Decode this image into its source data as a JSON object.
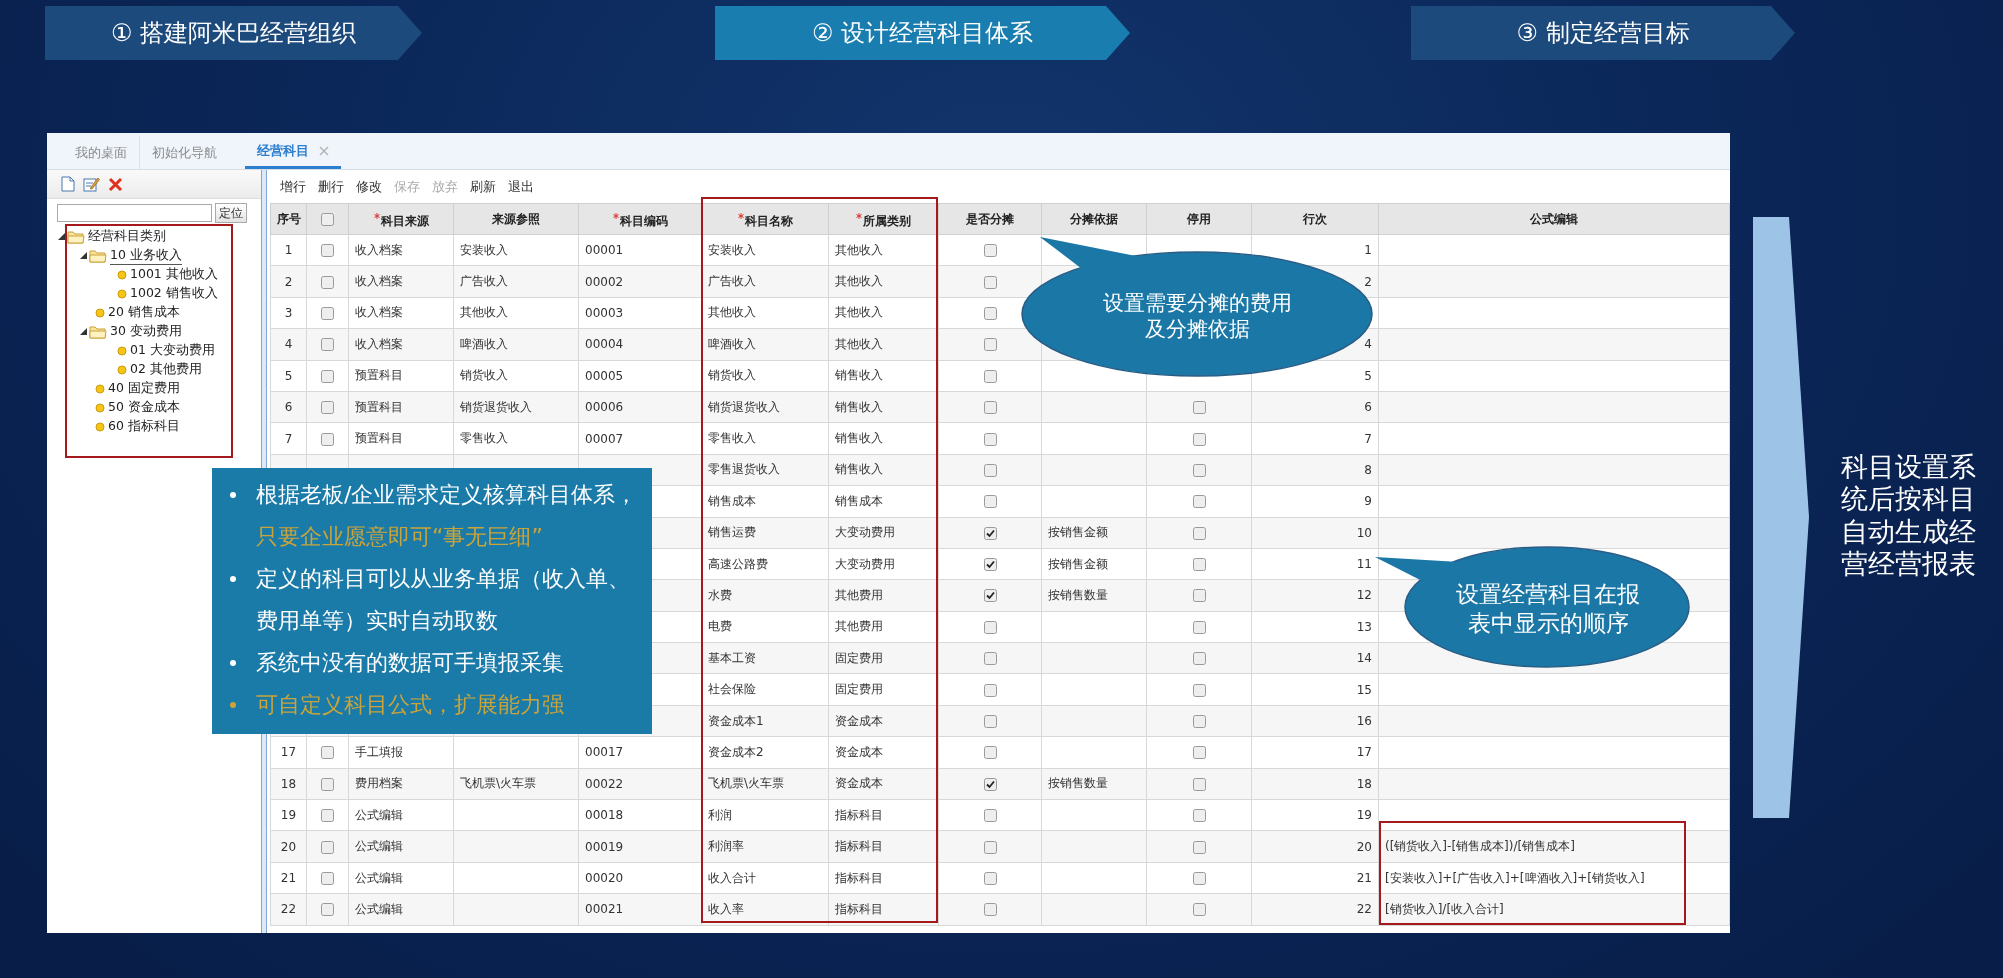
{
  "banners": [
    {
      "label": "① 搭建阿米巴经营组织",
      "selected": false
    },
    {
      "label": "② 设计经营科目体系",
      "selected": true
    },
    {
      "label": "③ 制定经营目标",
      "selected": false
    }
  ],
  "app": {
    "tabs": [
      {
        "label": "我的桌面",
        "selected": false,
        "closable": false
      },
      {
        "label": "初始化导航",
        "selected": false,
        "closable": false
      },
      {
        "label": "经营科目",
        "selected": true,
        "closable": true
      }
    ],
    "search": {
      "button": "定位"
    },
    "tree": {
      "items": [
        {
          "label": "经营科目类别",
          "kind": "folder",
          "expanded": true,
          "selected": false,
          "children": [
            {
              "label": "10 业务收入",
              "kind": "folder",
              "expanded": true,
              "selected": true,
              "children": [
                {
                  "label": "1001 其他收入",
                  "kind": "leaf",
                  "selected": false
                },
                {
                  "label": "1002 销售收入",
                  "kind": "leaf",
                  "selected": false
                }
              ]
            },
            {
              "label": "20 销售成本",
              "kind": "leaf",
              "selected": false
            },
            {
              "label": "30 变动费用",
              "kind": "folder",
              "expanded": true,
              "selected": false,
              "children": [
                {
                  "label": "01 大变动费用",
                  "kind": "leaf",
                  "selected": false
                },
                {
                  "label": "02 其他费用",
                  "kind": "leaf",
                  "selected": false
                }
              ]
            },
            {
              "label": "40 固定费用",
              "kind": "leaf",
              "selected": false
            },
            {
              "label": "50 资金成本",
              "kind": "leaf",
              "selected": false
            },
            {
              "label": "60 指标科目",
              "kind": "leaf",
              "selected": false
            }
          ]
        }
      ]
    },
    "toolbar": [
      {
        "label": "增行",
        "disabled": false
      },
      {
        "label": "删行",
        "disabled": false
      },
      {
        "label": "修改",
        "disabled": false
      },
      {
        "label": "保存",
        "disabled": true
      },
      {
        "label": "放弃",
        "disabled": true
      },
      {
        "label": "刷新",
        "disabled": false
      },
      {
        "label": "退出",
        "disabled": false
      }
    ],
    "table": {
      "columns": [
        {
          "kind": "text",
          "label": "序号",
          "required": false
        },
        {
          "kind": "checkbox",
          "checked": false
        },
        {
          "kind": "text",
          "label": "科目来源",
          "required": true
        },
        {
          "kind": "text",
          "label": "来源参照",
          "required": false
        },
        {
          "kind": "text",
          "label": "科目编码",
          "required": true
        },
        {
          "kind": "text",
          "label": "科目名称",
          "required": true
        },
        {
          "kind": "text",
          "label": "所属类别",
          "required": true
        },
        {
          "kind": "text",
          "label": "是否分摊",
          "required": false
        },
        {
          "kind": "text",
          "label": "分摊依据",
          "required": false
        },
        {
          "kind": "text",
          "label": "停用",
          "required": false
        },
        {
          "kind": "text",
          "label": "行次",
          "required": false
        },
        {
          "kind": "text",
          "label": "公式编辑",
          "required": false
        }
      ],
      "rows": [
        {
          "no": "1",
          "checked": false,
          "source": "收入档案",
          "ref": "安装收入",
          "code": "00001",
          "name": "安装收入",
          "category": "其他收入",
          "allocated": false,
          "order": "1"
        },
        {
          "no": "2",
          "checked": false,
          "source": "收入档案",
          "ref": "广告收入",
          "code": "00002",
          "name": "广告收入",
          "category": "其他收入",
          "allocated": false,
          "order": "2"
        },
        {
          "no": "3",
          "checked": false,
          "source": "收入档案",
          "ref": "其他收入",
          "code": "00003",
          "name": "其他收入",
          "category": "其他收入",
          "allocated": false
        },
        {
          "no": "4",
          "checked": false,
          "source": "收入档案",
          "ref": "啤酒收入",
          "code": "00004",
          "name": "啤酒收入",
          "category": "其他收入",
          "allocated": false,
          "order": "4"
        },
        {
          "no": "5",
          "checked": false,
          "source": "预置科目",
          "ref": "销货收入",
          "code": "00005",
          "name": "销货收入",
          "category": "销售收入",
          "allocated": false,
          "order": "5"
        },
        {
          "no": "6",
          "checked": false,
          "source": "预置科目",
          "ref": "销货退货收入",
          "code": "00006",
          "name": "销货退货收入",
          "category": "销售收入",
          "allocated": false,
          "stop_use": false,
          "order": "6"
        },
        {
          "no": "7",
          "checked": false,
          "source": "预置科目",
          "ref": "零售收入",
          "code": "00007",
          "name": "零售收入",
          "category": "销售收入",
          "allocated": false,
          "stop_use": false,
          "order": "7"
        },
        {
          "name": "零售退货收入",
          "category": "销售收入",
          "allocated": false,
          "stop_use": false,
          "order": "8"
        },
        {
          "name": "销售成本",
          "category": "销售成本",
          "allocated": false,
          "stop_use": false,
          "order": "9"
        },
        {
          "name": "销售运费",
          "category": "大变动费用",
          "allocated": true,
          "basis": "按销售金额",
          "stop_use": false,
          "order": "10"
        },
        {
          "name": "高速公路费",
          "category": "大变动费用",
          "allocated": true,
          "basis": "按销售金额",
          "stop_use": false,
          "order": "11"
        },
        {
          "name": "水费",
          "category": "其他费用",
          "allocated": true,
          "basis": "按销售数量",
          "stop_use": false,
          "order": "12"
        },
        {
          "name": "电费",
          "category": "其他费用",
          "allocated": false,
          "stop_use": false,
          "order": "13"
        },
        {
          "name": "基本工资",
          "category": "固定费用",
          "allocated": false,
          "stop_use": false,
          "order": "14"
        },
        {
          "name": "社会保险",
          "category": "固定费用",
          "allocated": false,
          "stop_use": false,
          "order": "15"
        },
        {
          "name": "资金成本1",
          "category": "资金成本",
          "allocated": false,
          "stop_use": false,
          "order": "16"
        },
        {
          "no": "17",
          "checked": false,
          "source": "手工填报",
          "code": "00017",
          "name": "资金成本2",
          "category": "资金成本",
          "allocated": false,
          "stop_use": false,
          "order": "17"
        },
        {
          "no": "18",
          "checked": false,
          "source": "费用档案",
          "ref": "飞机票\\火车票",
          "code": "00022",
          "name": "飞机票\\火车票",
          "category": "资金成本",
          "allocated": true,
          "basis": "按销售数量",
          "stop_use": false,
          "order": "18"
        },
        {
          "no": "19",
          "checked": false,
          "source": "公式编辑",
          "code": "00018",
          "name": "利润",
          "category": "指标科目",
          "allocated": false,
          "stop_use": false,
          "order": "19"
        },
        {
          "no": "20",
          "checked": false,
          "source": "公式编辑",
          "code": "00019",
          "name": "利润率",
          "category": "指标科目",
          "allocated": false,
          "stop_use": false,
          "order": "20",
          "formula": "([销货收入]-[销售成本])/[销售成本]"
        },
        {
          "no": "21",
          "checked": false,
          "source": "公式编辑",
          "code": "00020",
          "name": "收入合计",
          "category": "指标科目",
          "allocated": false,
          "stop_use": false,
          "order": "21",
          "formula": "[安装收入]+[广告收入]+[啤酒收入]+[销货收入]"
        },
        {
          "no": "22",
          "checked": false,
          "source": "公式编辑",
          "code": "00021",
          "name": "收入率",
          "category": "指标科目",
          "allocated": false,
          "stop_use": false,
          "order": "22",
          "formula": "[销货收入]/[收入合计]"
        }
      ]
    }
  },
  "callout": {
    "bullets": [
      {
        "highlight": false,
        "parts": [
          {
            "text": "根据老板/企业需求定义核算科目体系，",
            "highlight": false
          },
          {
            "text": "只要企业愿意即可“事无巨细”",
            "highlight": true
          }
        ]
      },
      {
        "highlight": false,
        "parts": [
          {
            "text": "定义的科目可以从业务单据（收入单、费用单等）实时自动取数",
            "highlight": false
          }
        ]
      },
      {
        "highlight": false,
        "parts": [
          {
            "text": "系统中没有的数据可手填报采集",
            "highlight": false
          }
        ]
      },
      {
        "highlight": true,
        "parts": [
          {
            "text": "可自定义科目公式，扩展能力强",
            "highlight": true
          }
        ]
      }
    ]
  },
  "bubbles": [
    {
      "text": "设置需要分摊的费用及分摊依据"
    },
    {
      "text": "设置经营科目在报表中显示的顺序"
    }
  ],
  "side_note": "科目设置系统后按科目自动生成经营经营报表"
}
